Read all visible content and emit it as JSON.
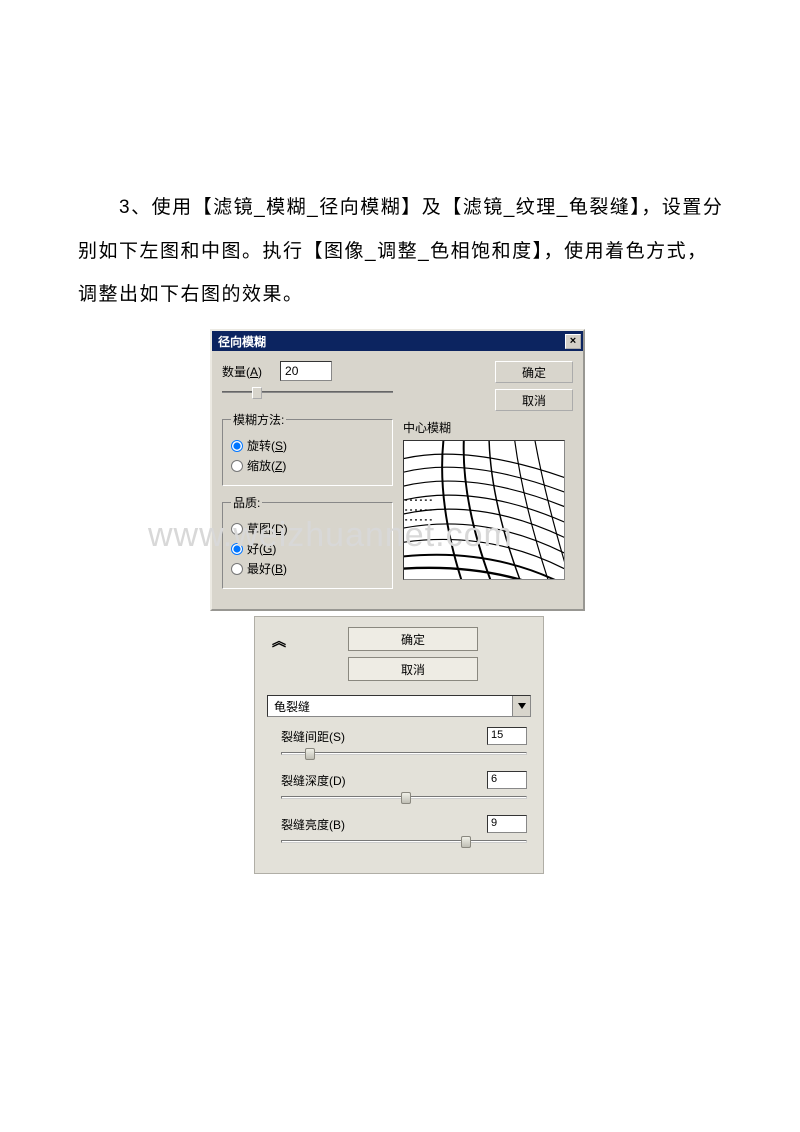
{
  "instruction": "　　3、使用【滤镜_模糊_径向模糊】及【滤镜_纹理_龟裂缝】，设置分别如下左图和中图。执行【图像_调整_色相饱和度】，使用着色方式，调整出如下右图的效果。",
  "watermark": "www.weizhuannet.com",
  "dialog1": {
    "title": "径向模糊",
    "closeGlyph": "×",
    "amountLabel": "数量(",
    "amountKey": "A",
    "amountLabelEnd": ")",
    "amountValue": "20",
    "okLabel": "确定",
    "cancelLabel": "取消",
    "methodLegend": "模糊方法:",
    "method1Label": "旋转(",
    "method1Key": "S",
    "method1End": ")",
    "method2Label": "缩放(",
    "method2Key": "Z",
    "method2End": ")",
    "qualityLegend": "品质:",
    "quality1Label": "草图(",
    "quality1Key": "D",
    "quality1End": ")",
    "quality2Label": "好(",
    "quality2Key": "G",
    "quality2End": ")",
    "quality3Label": "最好(",
    "quality3Key": "B",
    "quality3End": ")",
    "previewLabel": "中心模糊"
  },
  "dialog2": {
    "okLabel": "确定",
    "cancelLabel": "取消",
    "dropdownValue": "龟裂缝",
    "sliders": [
      {
        "label": "裂缝间距(",
        "key": "S",
        "end": ")",
        "value": "15",
        "thumbPos": 24
      },
      {
        "label": "裂缝深度(",
        "key": "D",
        "end": ")",
        "value": "6",
        "thumbPos": 120
      },
      {
        "label": "裂缝亮度(",
        "key": "B",
        "end": ")",
        "value": "9",
        "thumbPos": 180
      }
    ]
  }
}
